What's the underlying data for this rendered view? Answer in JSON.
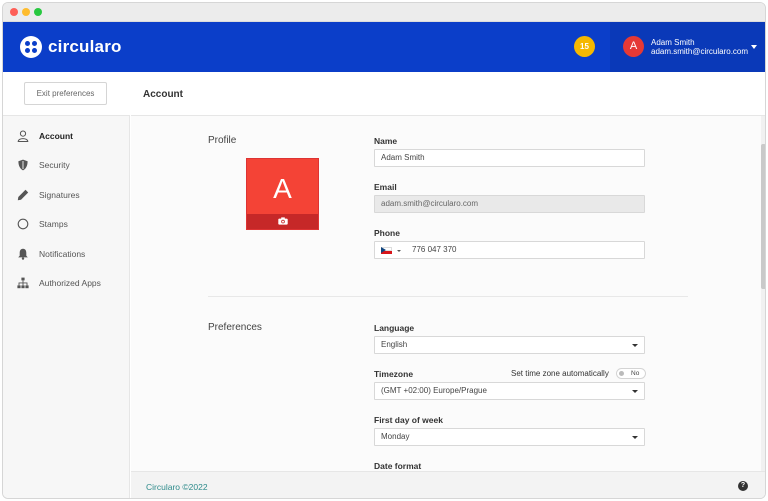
{
  "brand": {
    "name": "circularo",
    "color": "#0b3ec9"
  },
  "header": {
    "notification_count": "15",
    "user": {
      "initial": "A",
      "name": "Adam Smith",
      "email": "adam.smith@circularo.com"
    }
  },
  "sidebar": {
    "exit_label": "Exit preferences",
    "items": [
      {
        "label": "Account",
        "icon": "user-icon",
        "active": true
      },
      {
        "label": "Security",
        "icon": "shield-icon",
        "active": false
      },
      {
        "label": "Signatures",
        "icon": "pen-icon",
        "active": false
      },
      {
        "label": "Stamps",
        "icon": "circle-icon",
        "active": false
      },
      {
        "label": "Notifications",
        "icon": "bell-icon",
        "active": false
      },
      {
        "label": "Authorized Apps",
        "icon": "sitemap-icon",
        "active": false
      }
    ]
  },
  "page": {
    "title": "Account"
  },
  "profile": {
    "section_title": "Profile",
    "photo_initial": "A",
    "name_label": "Name",
    "name_value": "Adam Smith",
    "email_label": "Email",
    "email_value": "adam.smith@circularo.com",
    "phone_label": "Phone",
    "phone_value": "776 047 370"
  },
  "preferences": {
    "section_title": "Preferences",
    "language_label": "Language",
    "language_value": "English",
    "timezone_label": "Timezone",
    "timezone_auto_label": "Set time zone automatically",
    "timezone_auto_value": "No",
    "timezone_value": "(GMT +02:00) Europe/Prague",
    "first_day_label": "First day of week",
    "first_day_value": "Monday",
    "date_format_label": "Date format"
  },
  "footer": {
    "copyright": "Circularo ©2022",
    "help_glyph": "?"
  }
}
